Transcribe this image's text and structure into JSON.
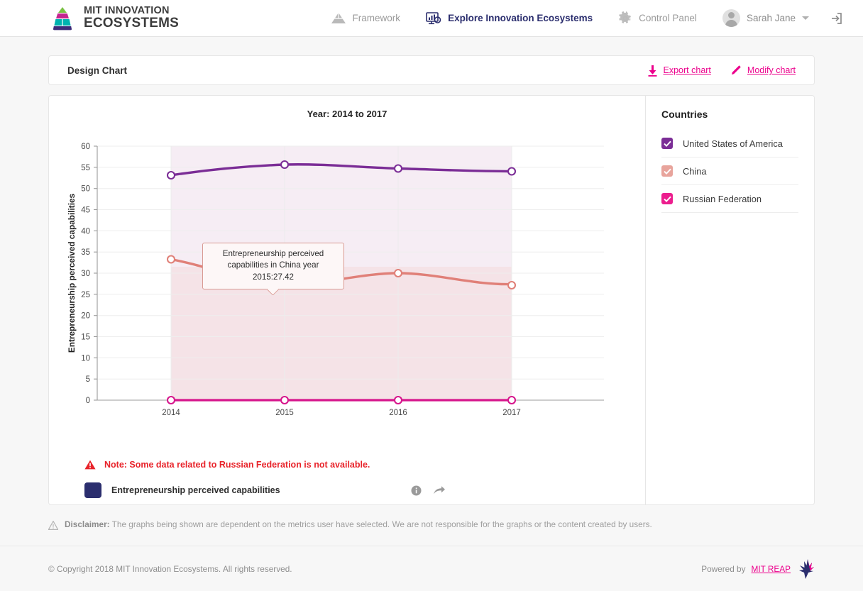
{
  "header": {
    "brand_line1": "MIT INNOVATION",
    "brand_line2": "ECOSYSTEMS",
    "nav": [
      {
        "label": "Framework",
        "icon": "pyramid-icon",
        "active": false
      },
      {
        "label": "Explore Innovation Ecosystems",
        "icon": "chart-monitor-icon",
        "active": true
      },
      {
        "label": "Control Panel",
        "icon": "gear-icon",
        "active": false
      }
    ],
    "user_name": "Sarah Jane",
    "logout_icon": "logout-icon"
  },
  "card": {
    "title": "Design Chart",
    "export_label": "Export chart",
    "modify_label": "Modify chart",
    "export_icon": "download-icon",
    "modify_icon": "pencil-icon"
  },
  "side": {
    "title": "Countries",
    "countries": [
      {
        "label": "United States of America",
        "checked": true,
        "color": "#7B2D96"
      },
      {
        "label": "China",
        "checked": true,
        "color": "#E8A49C"
      },
      {
        "label": "Russian Federation",
        "checked": true,
        "color": "#EC1E8E"
      }
    ]
  },
  "note": {
    "icon": "warning-triangle-icon",
    "text": "Note: Some data related to Russian Federation is not available."
  },
  "metric": {
    "swatch_color": "#2b2e6e",
    "label": "Entrepreneurship perceived capabilities",
    "info_icon": "info-icon",
    "share_icon": "share-arrow-icon"
  },
  "tooltip": {
    "line1": "Entrepreneurship perceived",
    "line2": "capabilities in China year",
    "line3": "2015:27.42"
  },
  "disclaimer": {
    "icon": "warning-triangle-icon",
    "bold": "Disclaimer:",
    "text": " The graphs being shown are dependent on the metrics user have selected. We are not responsible for the graphs or the content created by users."
  },
  "footer": {
    "copyright": "© Copyright 2018 MIT Innovation Ecosystems. All rights reserved.",
    "powered_prefix": "Powered by",
    "powered_link": "MIT REAP"
  },
  "chart_data": {
    "type": "line",
    "title": "Year: 2014 to 2017",
    "xlabel": "",
    "ylabel": "Entrepreneurship perceived capabilities",
    "categories": [
      "2014",
      "2015",
      "2016",
      "2017"
    ],
    "ylim": [
      0,
      60
    ],
    "yticks": [
      0,
      5,
      10,
      15,
      20,
      25,
      30,
      35,
      40,
      45,
      50,
      55,
      60
    ],
    "grid": true,
    "legend_position": "right-panel",
    "series": [
      {
        "name": "United States of America",
        "color": "#7B2D96",
        "values": [
          53.4,
          55.7,
          55.1,
          54.5
        ]
      },
      {
        "name": "China",
        "color": "#E08078",
        "values": [
          33.3,
          27.42,
          30.0,
          27.4
        ]
      },
      {
        "name": "Russian Federation",
        "color": "#D6168C",
        "values": [
          0,
          0,
          0,
          0
        ]
      }
    ],
    "annotation": "Entrepreneurship perceived capabilities in China year 2015:27.42"
  }
}
